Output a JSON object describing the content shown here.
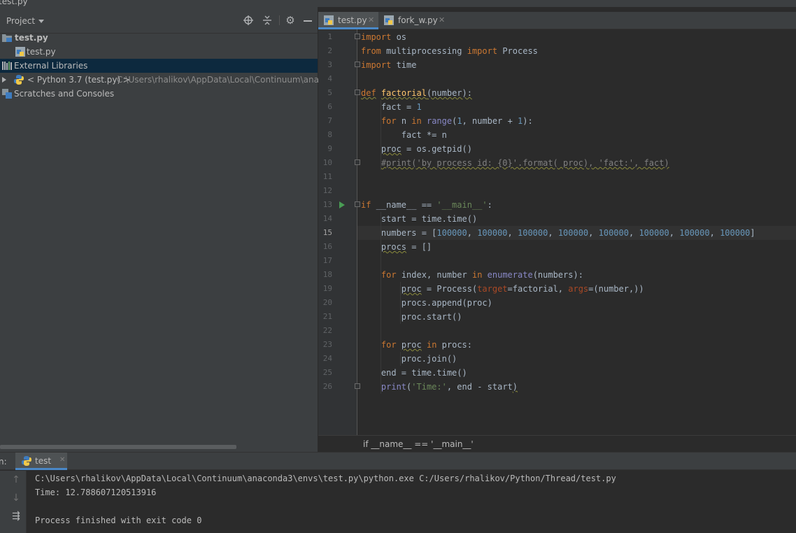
{
  "window": {
    "title": "test.py"
  },
  "project_panel": {
    "title": "Project",
    "icons": [
      "crosshair-icon",
      "collapse-icon",
      "gear-icon",
      "hide-icon"
    ],
    "tree": [
      {
        "label": "test.py",
        "icon": "folder-icon",
        "bold": true
      },
      {
        "label": "test.py",
        "icon": "python-file-icon"
      },
      {
        "label": "External Libraries",
        "icon": "library-icon",
        "selected": true
      },
      {
        "label": "< Python 3.7 (test.py) >",
        "path": "C:\\Users\\rhalikov\\AppData\\Local\\Continuum\\anaconda",
        "icon": "python-icon"
      },
      {
        "label": "Scratches and Consoles",
        "icon": "scratches-icon"
      }
    ]
  },
  "editor": {
    "tabs": [
      {
        "label": "test.py",
        "active": true
      },
      {
        "label": "fork_w.py",
        "active": false
      }
    ],
    "current_line": "15",
    "line_numbers": [
      "1",
      "2",
      "3",
      "4",
      "5",
      "6",
      "7",
      "8",
      "9",
      "10",
      "11",
      "12",
      "13",
      "14",
      "15",
      "16",
      "17",
      "18",
      "19",
      "20",
      "21",
      "22",
      "23",
      "24",
      "25",
      "26"
    ],
    "breadcrumb": "if __name__ == '__main__'"
  },
  "run_panel": {
    "label": "n:",
    "tab": "test",
    "console": [
      "C:\\Users\\rhalikov\\AppData\\Local\\Continuum\\anaconda3\\envs\\test.py\\python.exe C:/Users/rhalikov/Python/Thread/test.py",
      "Time: 12.788607120513916",
      "",
      "Process finished with exit code 0"
    ]
  }
}
